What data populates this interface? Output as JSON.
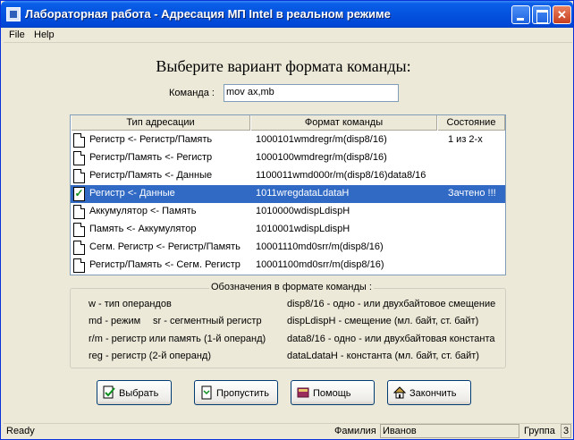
{
  "window": {
    "title": "Лабораторная работа - Адресация МП Intel в реальном режиме"
  },
  "menu": [
    "File",
    "Help"
  ],
  "heading": "Выберите вариант формата команды:",
  "command": {
    "label": "Команда :",
    "value": "mov ax,mb"
  },
  "table": {
    "columns": [
      "Тип адресации",
      "Формат команды",
      "Состояние"
    ],
    "rows": [
      {
        "type": "Регистр <- Регистр/Память",
        "format": "1000101wmdregr/m(disp8/16)",
        "status": "1 из 2-х",
        "icon": "doc-icon",
        "selected": false
      },
      {
        "type": "Регистр/Память <- Регистр",
        "format": "1000100wmdregr/m(disp8/16)",
        "status": "",
        "icon": "doc-icon",
        "selected": false
      },
      {
        "type": "Регистр/Память <- Данные",
        "format": "1100011wmd000r/m(disp8/16)data8/16",
        "status": "",
        "icon": "doc-icon",
        "selected": false
      },
      {
        "type": "Регистр <- Данные",
        "format": "1011wregdataLdataH",
        "status": "Зачтено !!!",
        "icon": "check-icon",
        "selected": true
      },
      {
        "type": "Аккумулятор <- Память",
        "format": "1010000wdispLdispH",
        "status": "",
        "icon": "doc-icon",
        "selected": false
      },
      {
        "type": "Память <- Аккумулятор",
        "format": "1010001wdispLdispH",
        "status": "",
        "icon": "doc-icon",
        "selected": false
      },
      {
        "type": "Сегм. Регистр <- Регистр/Память",
        "format": "10001110md0srr/m(disp8/16)",
        "status": "",
        "icon": "doc-icon",
        "selected": false
      },
      {
        "type": "Регистр/Память <- Сегм. Регистр",
        "format": "10001100md0srr/m(disp8/16)",
        "status": "",
        "icon": "doc-icon",
        "selected": false
      }
    ]
  },
  "legend": {
    "title": "Обозначения в формате команды :",
    "left": [
      "w - тип операндов",
      "md - режим",
      "sr - сегментный регистр",
      "r/m - регистр или память (1-й операнд)",
      "reg - регистр (2-й операнд)"
    ],
    "right": [
      "disp8/16 - одно - или двухбайтовое смещение",
      "dispLdispH - смещение (мл. байт, ст. байт)",
      "data8/16 - одно - или двухбайтовая константа",
      "dataLdataH - константа (мл. байт, ст. байт)"
    ]
  },
  "buttons": {
    "select": "Выбрать",
    "skip": "Пропустить",
    "help": "Помощь",
    "finish": "Закончить"
  },
  "status": {
    "ready": "Ready",
    "surname_label": "Фамилия",
    "surname_value": "Иванов",
    "group_label": "Группа",
    "group_value": "3"
  },
  "colors": {
    "titlebar": "#0454E0",
    "selection": "#316AC5",
    "check": "#0A8F1A"
  }
}
